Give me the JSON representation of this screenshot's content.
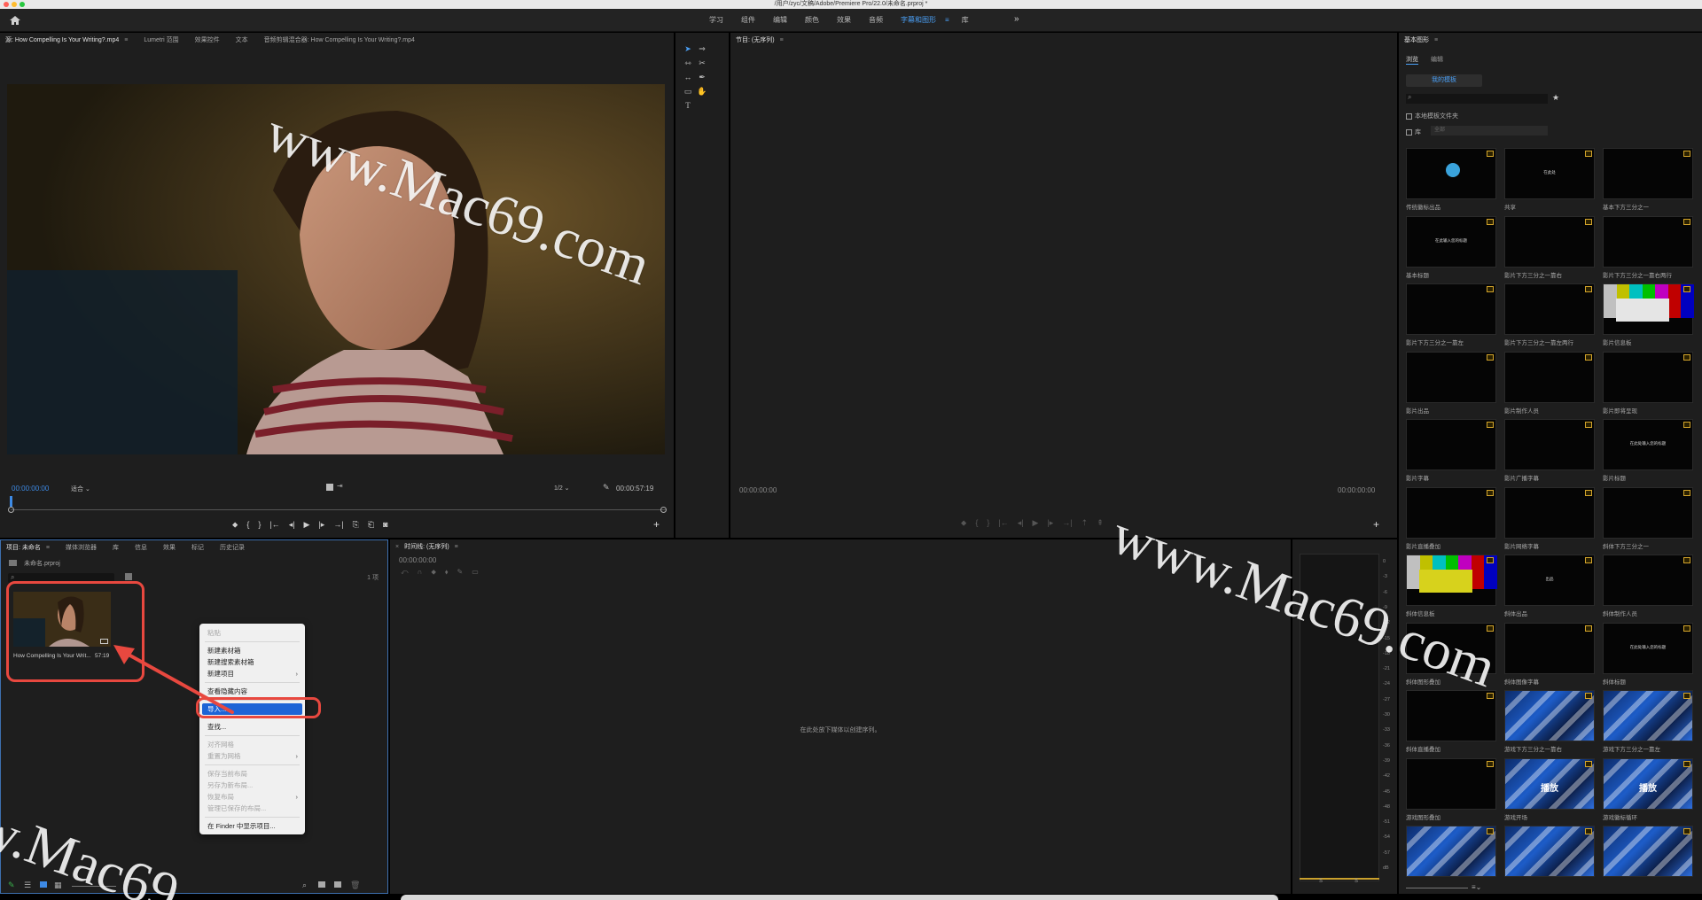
{
  "window": {
    "title": "/用户/zyc/文稿/Adobe/Premiere Pro/22.0/未命名.prproj *"
  },
  "workspaces": {
    "tabs": [
      "学习",
      "组件",
      "编辑",
      "颜色",
      "效果",
      "音频",
      "字幕和图形",
      "库"
    ],
    "active_index": 6,
    "more": "»"
  },
  "source_panel": {
    "tabs": [
      "源: How Compelling Is Your Writing?.mp4",
      "Lumetri 范围",
      "效果控件",
      "文本",
      "音频剪辑混合器: How Compelling Is Your Writing?.mp4"
    ],
    "timecode_in": "00:00:00:00",
    "fit": "适合",
    "resolution": "1/2",
    "timecode_out": "00:00:57:19"
  },
  "program_panel": {
    "title": "节目: (无序列)",
    "timecode_in": "00:00:00:00",
    "timecode_out": "00:00:00:00"
  },
  "project_panel": {
    "tabs": [
      "项目: 未命名",
      "媒体浏览器",
      "库",
      "信息",
      "效果",
      "标记",
      "历史记录"
    ],
    "file_name": "未命名.prproj",
    "item_count": "1 项",
    "clip": {
      "name": "How Compelling Is Your Writ...",
      "duration": "57:19"
    }
  },
  "context_menu": {
    "items": [
      {
        "label": "粘贴",
        "disabled": true
      },
      {
        "sep": true
      },
      {
        "label": "新建素材箱"
      },
      {
        "label": "新建搜索素材箱"
      },
      {
        "label": "新建项目",
        "submenu": true
      },
      {
        "sep": true
      },
      {
        "label": "查看隐藏内容"
      },
      {
        "sep": true
      },
      {
        "label": "导入...",
        "highlight": true
      },
      {
        "sep": true
      },
      {
        "label": "查找..."
      },
      {
        "sep": true
      },
      {
        "label": "对齐网格",
        "disabled": true
      },
      {
        "label": "重置为网格",
        "disabled": true,
        "submenu": true
      },
      {
        "sep": true
      },
      {
        "label": "保存当前布局",
        "disabled": true
      },
      {
        "label": "另存为新布局...",
        "disabled": true
      },
      {
        "label": "恢复布局",
        "disabled": true,
        "submenu": true
      },
      {
        "label": "管理已保存的布局...",
        "disabled": true
      },
      {
        "sep": true
      },
      {
        "label": "在 Finder 中显示项目..."
      }
    ]
  },
  "timeline_panel": {
    "title": "时间线: (无序列)",
    "timecode": "00:00:00:00",
    "empty_hint": "在此处放下媒体以创建序列。"
  },
  "audio_meter": {
    "scale": [
      "0",
      "-3",
      "-6",
      "-9",
      "-12",
      "-15",
      "-18",
      "-21",
      "-24",
      "-27",
      "-30",
      "-33",
      "-36",
      "-39",
      "-42",
      "-45",
      "-48",
      "-51",
      "-54",
      "-57",
      "dB"
    ],
    "channels": [
      "S",
      "S"
    ]
  },
  "graphics_panel": {
    "title": "基本图形",
    "tabs": [
      "浏览",
      "编辑"
    ],
    "my_templates": "我的模板",
    "local_folder_label": "本地模板文件夹",
    "library_label": "库",
    "library_select": "全部",
    "templates": [
      "传统徽标出品",
      "共享",
      "基本下方三分之一",
      "基本标题",
      "影片下方三分之一靠右",
      "影片下方三分之一靠右两行",
      "影片下方三分之一靠左",
      "影片下方三分之一靠左两行",
      "影片信息板",
      "影片出品",
      "影片制作人员",
      "影片即将呈现",
      "影片字幕",
      "影片广播字幕",
      "影片标题",
      "影片直播叠加",
      "影片网络字幕",
      "斜体下方三分之一",
      "斜体信息板",
      "斜体出品",
      "斜体制作人员",
      "斜体图形叠加",
      "斜体图像字幕",
      "斜体标题",
      "斜体直播叠加",
      "游戏下方三分之一靠右",
      "游戏下方三分之一靠左",
      "游戏图形叠加",
      "游戏开场",
      "游戏徽标循环",
      "",
      "",
      ""
    ],
    "thumb_texts": [
      "",
      "在此处",
      "",
      "在此输入您的标题",
      "",
      "",
      "",
      "",
      "",
      "",
      "",
      "",
      "",
      "",
      "在此处输入您的标题",
      "",
      "",
      "",
      "",
      "出品",
      "",
      "",
      "",
      "在此处输入您的标题",
      "",
      "",
      "",
      "",
      "播放",
      "播放"
    ]
  },
  "watermarks": [
    "www.Mac69.com",
    "www.Mac69.com",
    "w.Mac69"
  ],
  "colors": {
    "accent": "#3d8ae5",
    "annotation": "#e8483f",
    "highlight": "#1d64d6"
  }
}
